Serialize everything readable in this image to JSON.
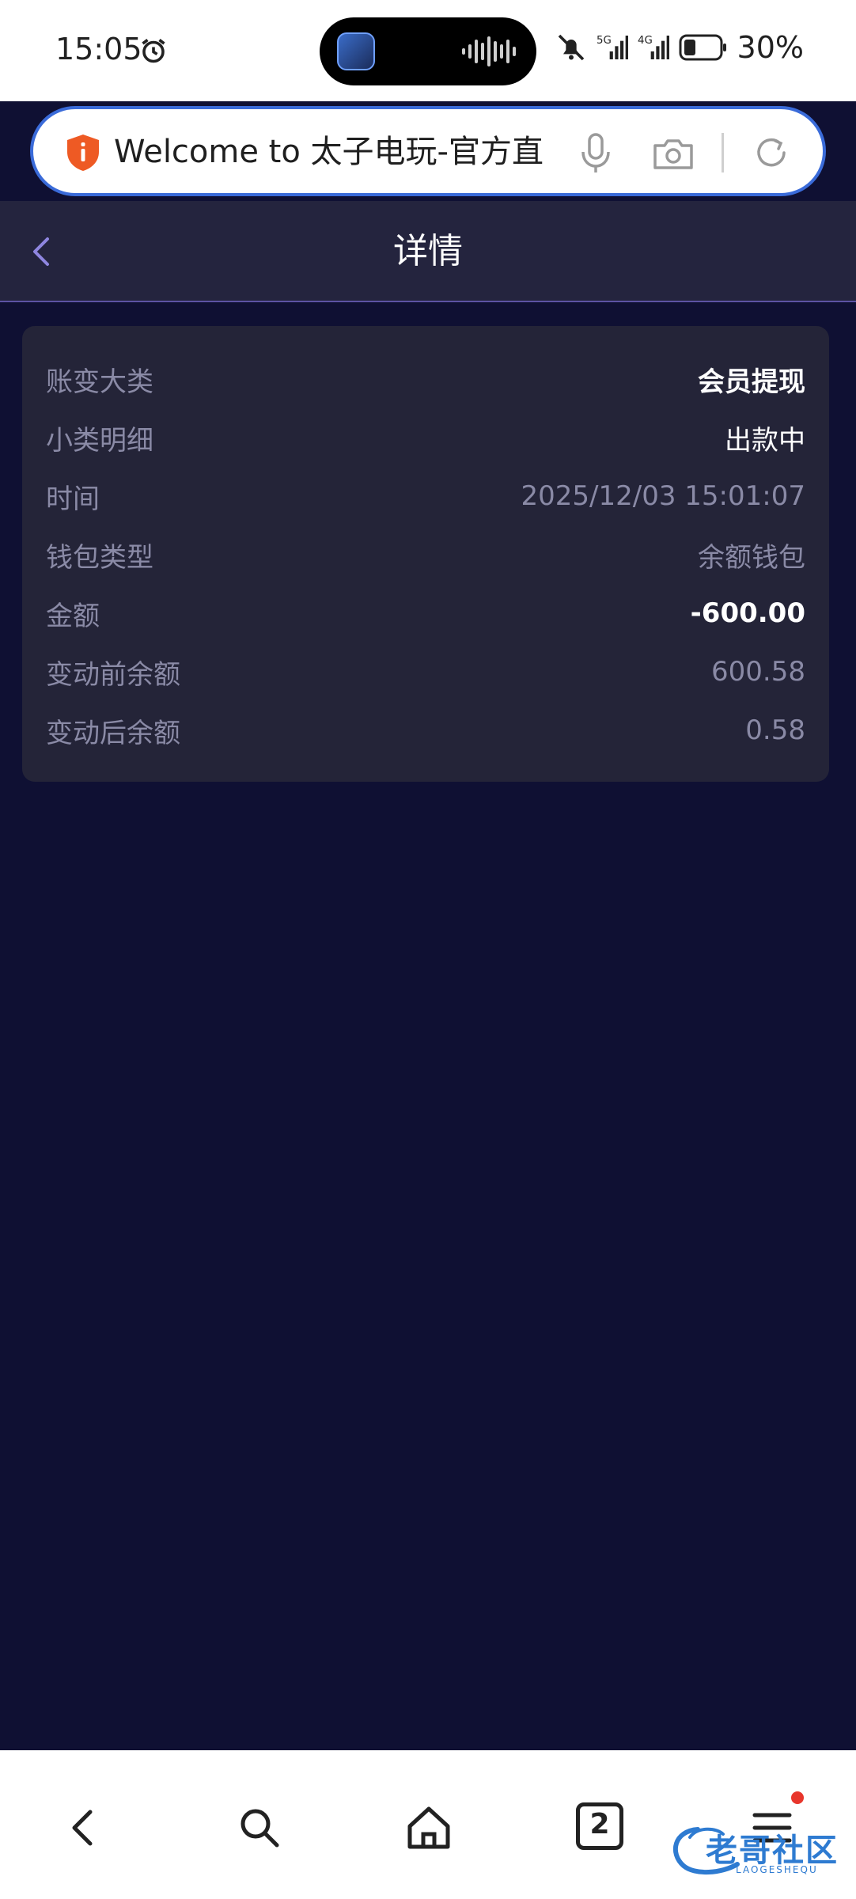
{
  "status_bar": {
    "time": "15:05",
    "battery_percent": "30%",
    "network_1": "5G",
    "network_2": "4G",
    "icons": [
      "alarm-icon",
      "app-icon",
      "audio-wave-icon",
      "mute-icon",
      "signal-icon",
      "battery-icon"
    ]
  },
  "browser": {
    "address_text": "Welcome to 太子电玩-官方直",
    "icons": [
      "shield-icon",
      "mic-icon",
      "camera-icon",
      "reload-icon"
    ]
  },
  "page": {
    "title": "详情",
    "back_icon": "chevron-left-icon"
  },
  "details": [
    {
      "label": "账变大类",
      "value": "会员提现",
      "style": "bold-white"
    },
    {
      "label": "小类明细",
      "value": "出款中",
      "style": "white"
    },
    {
      "label": "时间",
      "value": "2025/12/03 15:01:07",
      "style": "muted"
    },
    {
      "label": "钱包类型",
      "value": "余额钱包",
      "style": "muted"
    },
    {
      "label": "金额",
      "value": "-600.00",
      "style": "bold-white"
    },
    {
      "label": "变动前余额",
      "value": "600.58",
      "style": "muted"
    },
    {
      "label": "变动后余额",
      "value": "0.58",
      "style": "muted"
    }
  ],
  "bottom_nav": {
    "tabs_count": "2",
    "items": [
      "back-icon",
      "search-icon",
      "home-icon",
      "tabs-icon",
      "menu-icon"
    ]
  },
  "watermark": {
    "text": "老哥社区",
    "sub": "LAOGESHEQU"
  },
  "colors": {
    "page_bg": "#0f1033",
    "header_bg": "#24243e",
    "card_bg": "#242438",
    "muted_text": "#8a8aa6",
    "accent": "#3a6bd9"
  }
}
